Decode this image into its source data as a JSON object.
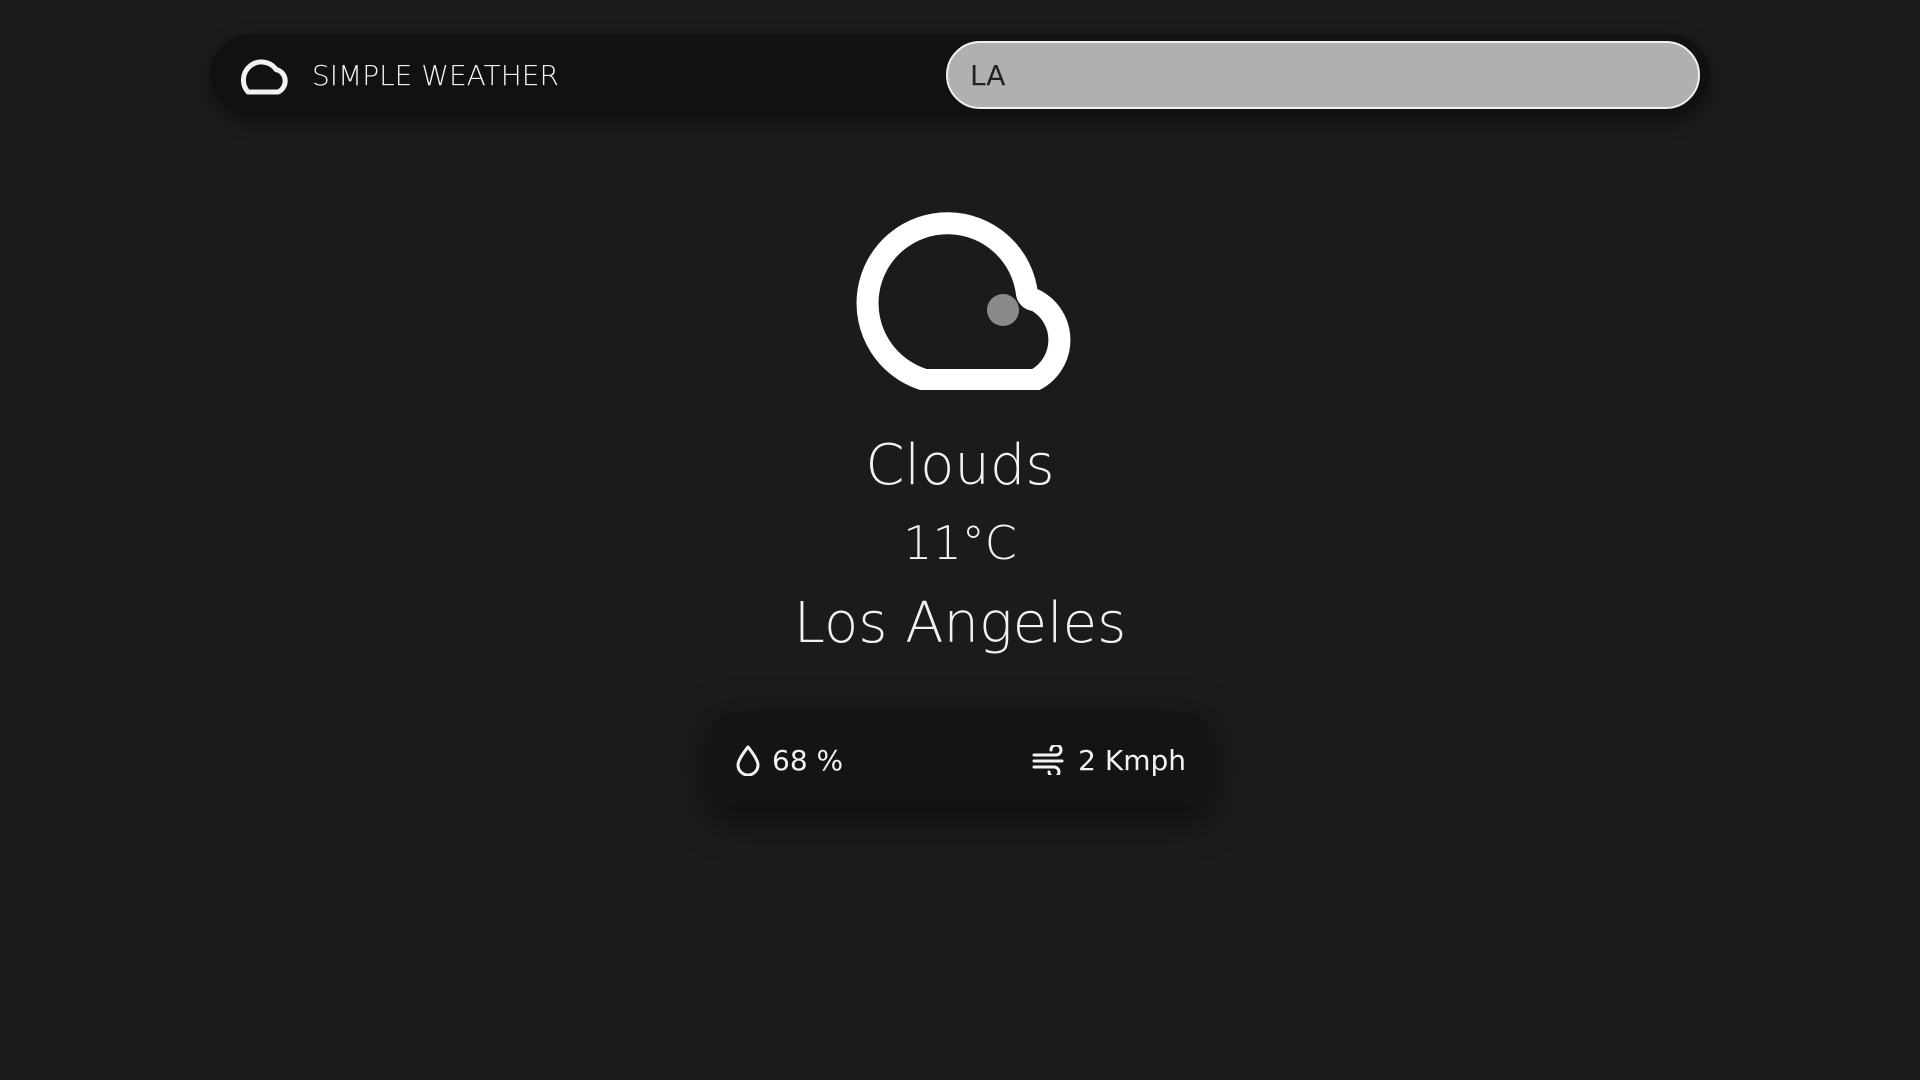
{
  "app": {
    "title": "SIMPLE WEATHER",
    "logo_icon": "cloud-icon"
  },
  "search": {
    "value": "LA",
    "placeholder": ""
  },
  "weather": {
    "icon": "cloud-icon",
    "condition": "Clouds",
    "temperature": "11°C",
    "city": "Los Angeles"
  },
  "details": {
    "humidity_icon": "droplet-icon",
    "humidity": "68 %",
    "wind_icon": "wind-icon",
    "wind": "2 Kmph"
  },
  "colors": {
    "background": "#1b1b1b",
    "bar": "#111111",
    "search_bg": "#b0b0b0",
    "text": "#f2f2f2",
    "accent_dot": "#8a8a8a"
  }
}
